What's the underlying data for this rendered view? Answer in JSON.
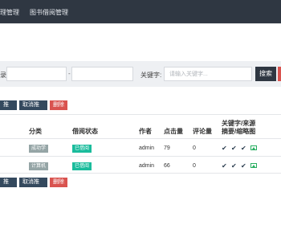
{
  "nav": {
    "item1": "理管理",
    "item2": "图书借阅管理"
  },
  "filter": {
    "label_left": "录:",
    "dash": "-",
    "keyword_label": "关键字:",
    "keyword_placeholder": "请输入关键字...",
    "search_label": "搜索"
  },
  "toolbar": {
    "recommend": "推荐",
    "cancel_recommend": "取消推荐",
    "delete": "删除"
  },
  "table": {
    "headers": {
      "category": "分类",
      "borrow_status": "借阅状态",
      "author": "作者",
      "clicks": "点击量",
      "comments": "评论量",
      "extra_line1": "关键字/来源",
      "extra_line2": "摘要/缩略图"
    },
    "rows": [
      {
        "category": "成功学",
        "status": "已借阅",
        "author": "admin",
        "clicks": "79",
        "comments": "0"
      },
      {
        "category": "计算机",
        "status": "已借阅",
        "author": "admin",
        "clicks": "66",
        "comments": "0"
      }
    ]
  },
  "icons": {
    "check": "✔",
    "image": "image-icon"
  },
  "colors": {
    "topbar": "#2f3742",
    "tag_green": "#1abc9c",
    "tag_gray": "#95a5a6",
    "delete_red": "#d9534f",
    "button_dark": "#34495e"
  }
}
